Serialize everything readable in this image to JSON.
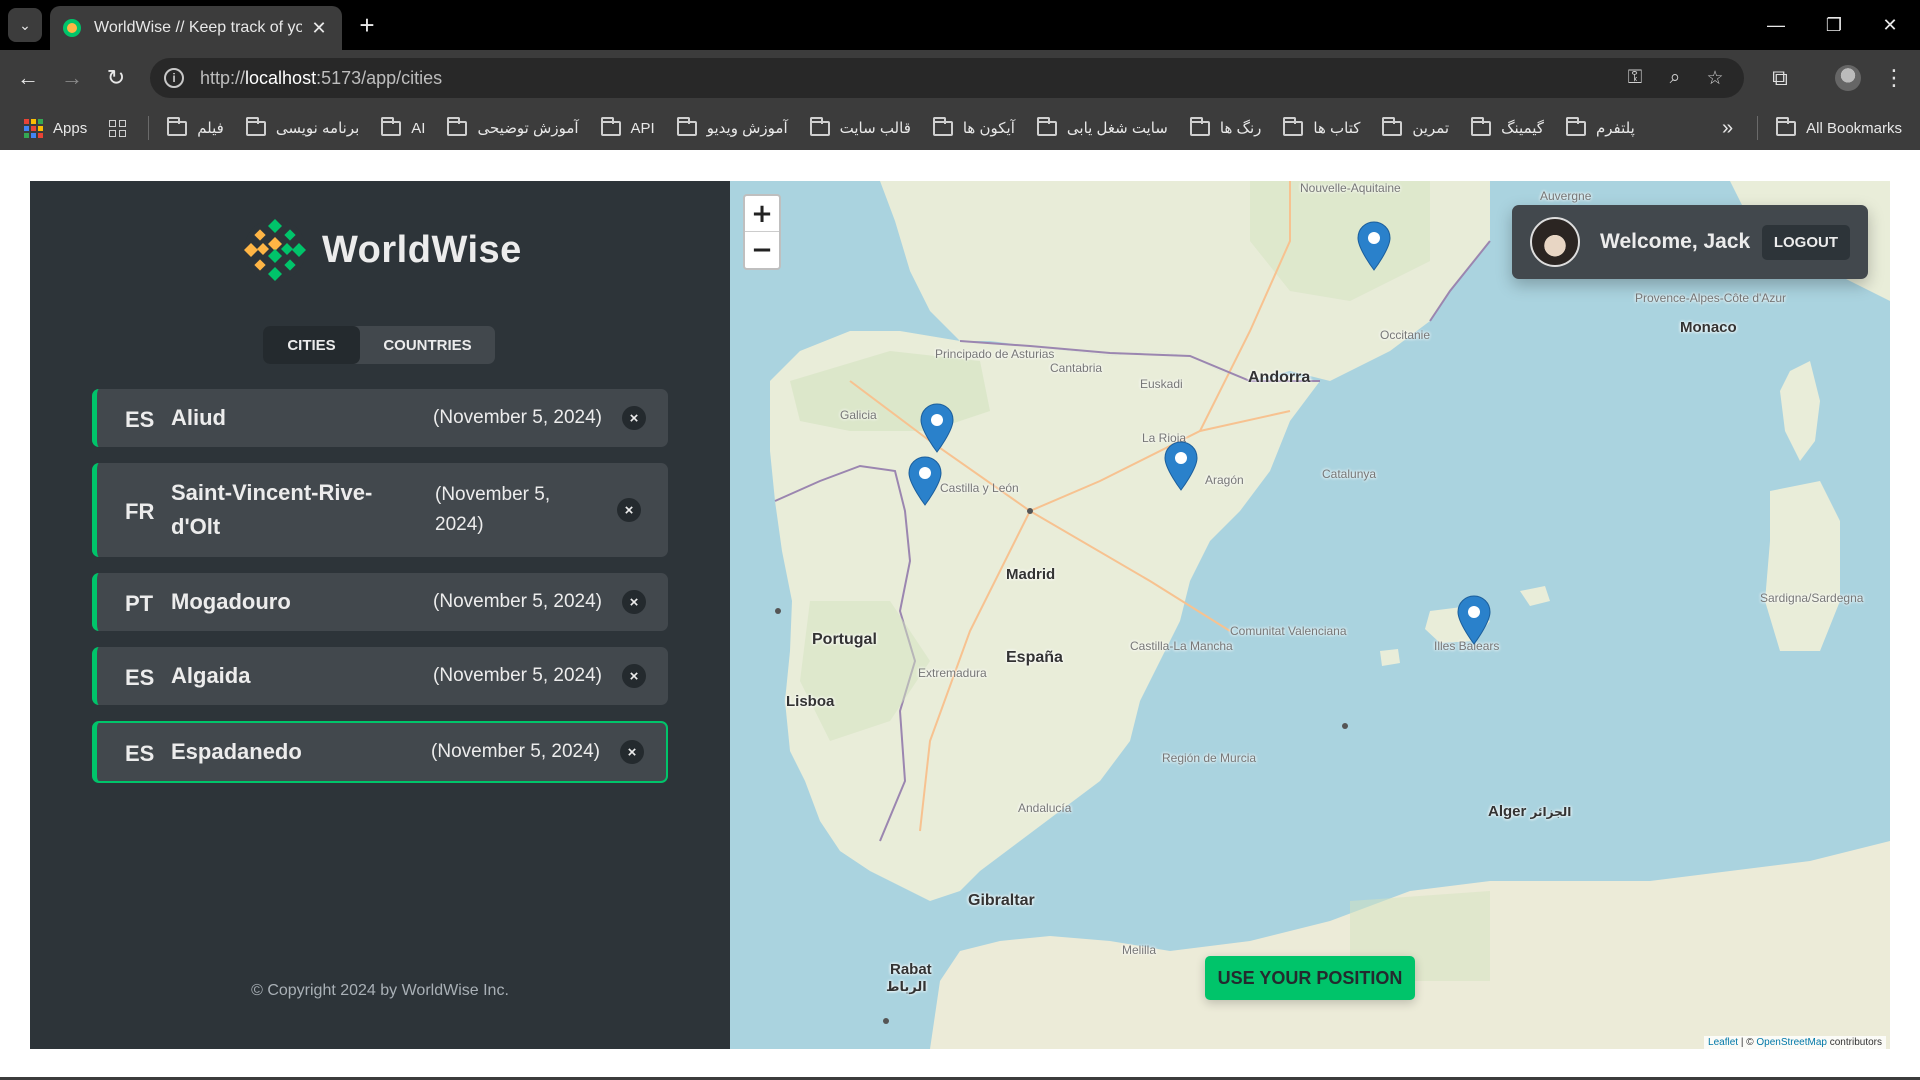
{
  "browser": {
    "tab_title": "WorldWise // Keep track of you",
    "url_prefix": "http://",
    "url_host": "localhost",
    "url_rest": ":5173/app/cities",
    "bookmarks": [
      {
        "label": "Apps",
        "type": "apps"
      },
      {
        "label": "فیلم",
        "type": "folder"
      },
      {
        "label": "برنامه نویسی",
        "type": "folder"
      },
      {
        "label": "AI",
        "type": "folder"
      },
      {
        "label": "آموزش توضیحی",
        "type": "folder"
      },
      {
        "label": "API",
        "type": "folder"
      },
      {
        "label": "آموزش ویدیو",
        "type": "folder"
      },
      {
        "label": "قالب سایت",
        "type": "folder"
      },
      {
        "label": "آیکون ها",
        "type": "folder"
      },
      {
        "label": "سایت شغل یابی",
        "type": "folder"
      },
      {
        "label": "رنگ ها",
        "type": "folder"
      },
      {
        "label": "کتاب ها",
        "type": "folder"
      },
      {
        "label": "تمرین",
        "type": "folder"
      },
      {
        "label": "گیمینگ",
        "type": "folder"
      },
      {
        "label": "پلتفرم",
        "type": "folder"
      }
    ],
    "all_bookmarks": "All Bookmarks",
    "more_glyph": "»"
  },
  "sidebar": {
    "app_name": "WorldWise",
    "tabs": [
      {
        "label": "CITIES",
        "active": true
      },
      {
        "label": "COUNTRIES",
        "active": false
      }
    ],
    "cities": [
      {
        "code": "ES",
        "name": "Aliud",
        "date": "(November 5, 2024)"
      },
      {
        "code": "FR",
        "name": "Saint-Vincent-Rive-d'Olt",
        "date": "(November 5, 2024)"
      },
      {
        "code": "PT",
        "name": "Mogadouro",
        "date": "(November 5, 2024)"
      },
      {
        "code": "ES",
        "name": "Algaida",
        "date": "(November 5, 2024)"
      },
      {
        "code": "ES",
        "name": "Espadanedo",
        "date": "(November 5, 2024)"
      }
    ],
    "copyright": "© Copyright 2024 by WorldWise Inc."
  },
  "map": {
    "zoom_in": "+",
    "zoom_out": "−",
    "user": {
      "welcome": "Welcome, Jack",
      "logout": "LOGOUT"
    },
    "use_position": "USE YOUR POSITION",
    "attribution": {
      "leaflet": "Leaflet",
      "sep": " | © ",
      "osm": "OpenStreetMap",
      "tail": " contributors"
    },
    "labels": {
      "andorra": "Andorra",
      "monaco": "Monaco",
      "madrid": "Madrid",
      "espana": "España",
      "portugal": "Portugal",
      "lisboa": "Lisboa",
      "gibraltar": "Gibraltar",
      "alger": "Alger",
      "alger_ar": "الجزائر",
      "rabat": "Rabat",
      "rabat_ar": "الرباط",
      "occitanie": "Occitanie",
      "nouvelle_aquitaine": "Nouvelle-Aquitaine",
      "auvergne": "Auvergne",
      "sardegna": "Sardigna/Sardegna",
      "castilla_leon": "Castilla y León",
      "aragon": "Aragón",
      "catalunya": "Catalunya",
      "galicia": "Galicia",
      "asturias": "Principado de Asturias",
      "cantabria": "Cantabria",
      "euskadi": "Euskadi",
      "la_rioja": "La Rioja",
      "valenciana": "Comunitat Valenciana",
      "castilla_mancha": "Castilla-La Mancha",
      "extremadura": "Extremadura",
      "andalucia": "Andalucía",
      "murcia": "Región de Murcia",
      "illes_balears": "Illes Balears",
      "melilla": "Melilla",
      "provence": "Provence-Alpes-Côte d'Azur"
    }
  }
}
